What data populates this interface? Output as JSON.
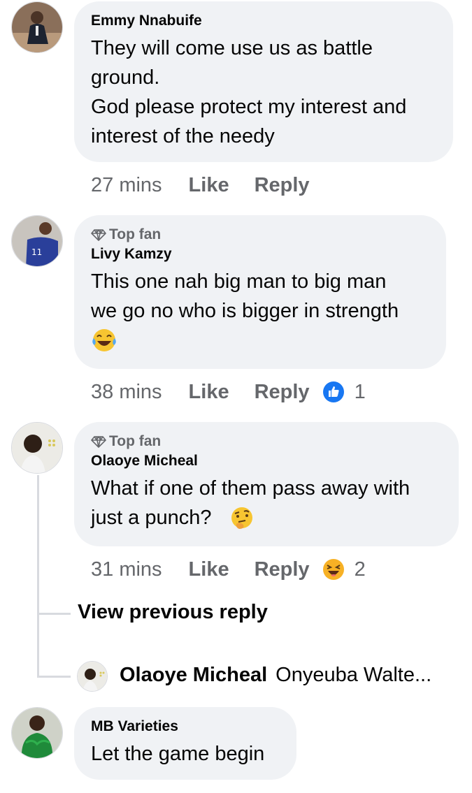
{
  "comments": [
    {
      "author": "Emmy Nnabuife",
      "text": "They will come use us as battle\nground.\nGod please protect my interest and\ninterest of the needy",
      "time": "27 mins",
      "like_label": "Like",
      "reply_label": "Reply"
    },
    {
      "badge": "Top fan",
      "author": "Livy Kamzy",
      "text": "This one nah big man to big man\nwe go no who is bigger in strength",
      "emoji": "laughing-tears",
      "time": "38 mins",
      "like_label": "Like",
      "reply_label": "Reply",
      "reaction": "like-icon",
      "reaction_count": "1"
    },
    {
      "badge": "Top fan",
      "author": "Olaoye Micheal",
      "text": "What if one of them pass away with\njust a punch?",
      "emoji": "thinking-face",
      "time": "31 mins",
      "like_label": "Like",
      "reply_label": "Reply",
      "reaction": "haha-icon",
      "reaction_count": "2"
    },
    {
      "author": "MB Varieties",
      "text": "Let the game begin"
    }
  ],
  "thread": {
    "view_previous": "View previous reply",
    "reply_author": "Olaoye Micheal",
    "reply_snippet": "Onyeuba Walte..."
  },
  "colors": {
    "bubble": "#f0f2f5",
    "meta_text": "#65676b",
    "like_blue": "#1877f2",
    "haha_yellow": "#f7b125"
  }
}
